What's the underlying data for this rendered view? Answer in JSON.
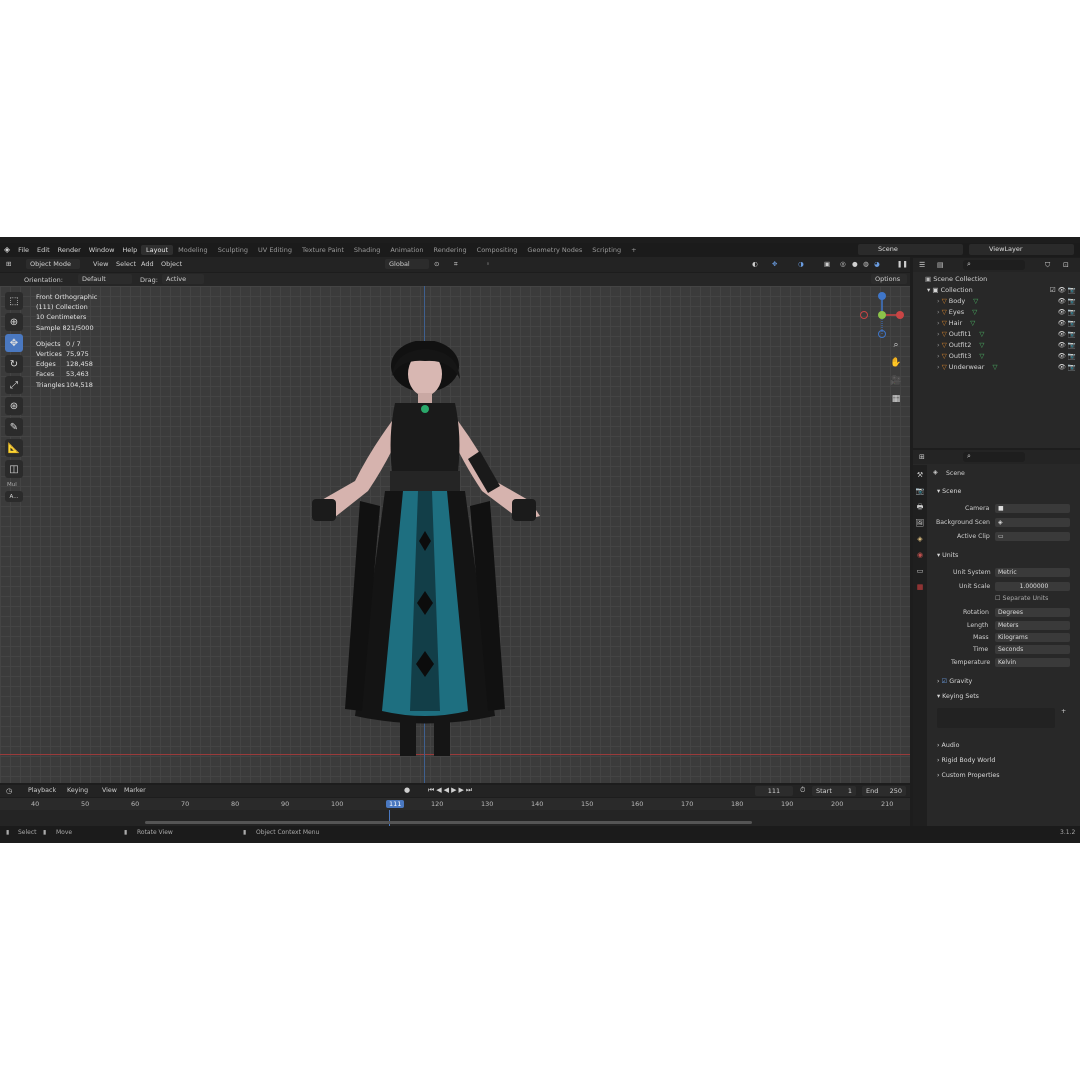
{
  "menu": [
    "File",
    "Edit",
    "Render",
    "Window",
    "Help"
  ],
  "workspaces": [
    "Layout",
    "Modeling",
    "Sculpting",
    "UV Editing",
    "Texture Paint",
    "Shading",
    "Animation",
    "Rendering",
    "Compositing",
    "Geometry Nodes",
    "Scripting"
  ],
  "scene_name": "Scene",
  "view_layer": "ViewLayer",
  "header": {
    "mode": "Object Mode",
    "view": "View",
    "select": "Select",
    "add": "Add",
    "object": "Object",
    "transform": "Global",
    "orientation_label": "Orientation:",
    "orientation_value": "Default",
    "drag_label": "Drag:",
    "drag_value": "Active Tool",
    "options": "Options"
  },
  "overlay": {
    "view_name": "Front Orthographic",
    "collection": "(111) Collection",
    "scale": "10 Centimeters",
    "sample": "Sample 821/5000",
    "stats": [
      {
        "k": "Objects",
        "v": "0 / 7"
      },
      {
        "k": "Vertices",
        "v": "75,975"
      },
      {
        "k": "Edges",
        "v": "128,458"
      },
      {
        "k": "Faces",
        "v": "53,463"
      },
      {
        "k": "Triangles",
        "v": "104,518"
      }
    ]
  },
  "toolbar_extra": {
    "mul": "Mul",
    "a": "A..."
  },
  "outliner": {
    "root": "Scene Collection",
    "collection": "Collection",
    "items": [
      "Body",
      "Eyes",
      "Hair",
      "Outfit1",
      "Outfit2",
      "Outfit3",
      "Underwear"
    ]
  },
  "properties": {
    "context": "Scene",
    "scene_section": "Scene",
    "camera_label": "Camera",
    "bg_label": "Background Scen",
    "clip_label": "Active Clip",
    "units_section": "Units",
    "unit_system_label": "Unit System",
    "unit_system": "Metric",
    "unit_scale_label": "Unit Scale",
    "unit_scale": "1.000000",
    "separate_units": "Separate Units",
    "rotation_label": "Rotation",
    "rotation": "Degrees",
    "length_label": "Length",
    "length": "Meters",
    "mass_label": "Mass",
    "mass": "Kilograms",
    "time_label": "Time",
    "time": "Seconds",
    "temperature_label": "Temperature",
    "temperature": "Kelvin",
    "gravity": "Gravity",
    "keying_sets": "Keying Sets",
    "audio": "Audio",
    "rigid_body": "Rigid Body World",
    "custom_props": "Custom Properties"
  },
  "timeline": {
    "playback": "Playback",
    "keying": "Keying",
    "view": "View",
    "marker": "Marker",
    "current_frame": "111",
    "start_label": "Start",
    "start": "1",
    "end_label": "End",
    "end": "250",
    "ticks": [
      "40",
      "50",
      "60",
      "70",
      "80",
      "90",
      "100",
      "111",
      "120",
      "130",
      "140",
      "150",
      "160",
      "170",
      "180",
      "190",
      "200",
      "210"
    ]
  },
  "status": {
    "select": "Select",
    "move": "Move",
    "rotate": "Rotate View",
    "context_menu": "Object Context Menu",
    "version": "3.1.2"
  },
  "colors": {
    "accent": "#4a78c0",
    "bg": "#1d1d1d",
    "viewport": "#3b3b3b",
    "collection_icon": "#e08a2e",
    "mesh_icon": "#4fbf6a"
  }
}
